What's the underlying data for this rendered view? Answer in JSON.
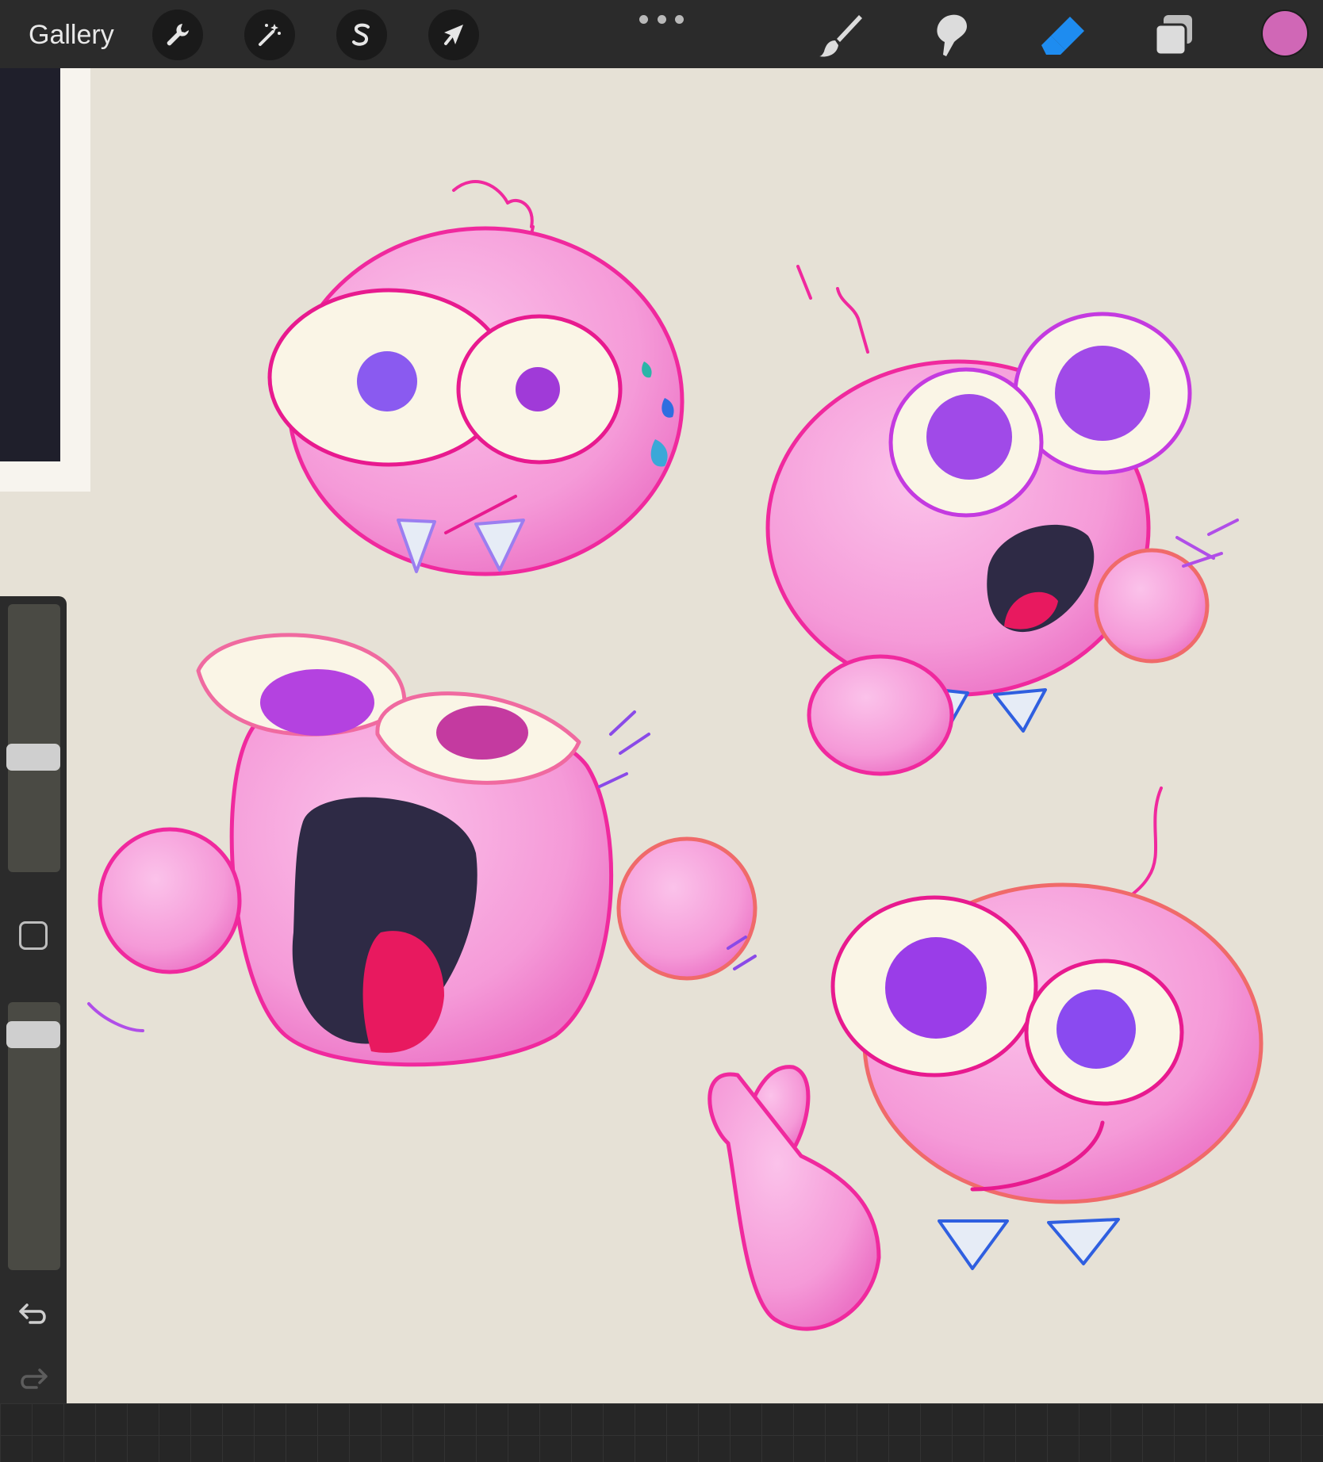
{
  "toolbar": {
    "gallery_label": "Gallery",
    "left_tools": [
      {
        "name": "actions",
        "icon": "wrench-icon"
      },
      {
        "name": "adjustments",
        "icon": "magic-wand-icon"
      },
      {
        "name": "selection",
        "icon": "selection-s-icon"
      },
      {
        "name": "transform",
        "icon": "arrow-cursor-icon"
      }
    ],
    "more_icon": "more-dots-icon",
    "right_tools": [
      {
        "name": "brush",
        "icon": "brush-icon",
        "active": false
      },
      {
        "name": "smudge",
        "icon": "smudge-icon",
        "active": false
      },
      {
        "name": "eraser",
        "icon": "eraser-icon",
        "active": true
      },
      {
        "name": "layers",
        "icon": "layers-icon",
        "active": false
      }
    ],
    "current_color": "#d067b6",
    "active_tool_color": "#1e8cf0"
  },
  "sidebar": {
    "brush_size_level": 0.42,
    "opacity_level": 0.92,
    "modify_icon": "square-modify-icon",
    "undo_icon": "undo-icon",
    "redo_icon": "redo-icon"
  },
  "canvas": {
    "paper_color": "#e6e1d6",
    "palette": {
      "body": "#f59ad8",
      "outline": "#f0299e",
      "eye_white": "#faf5e6",
      "pupil": "#9a3de8",
      "mouth": "#2e2a45",
      "tongue": "#e8195f",
      "teeth": "#e6ecf6",
      "sweat": "#3aa8d8"
    },
    "characters": [
      "worried-character",
      "dizzy-shocked-character",
      "screaming-character",
      "thumbs-up-character"
    ]
  }
}
